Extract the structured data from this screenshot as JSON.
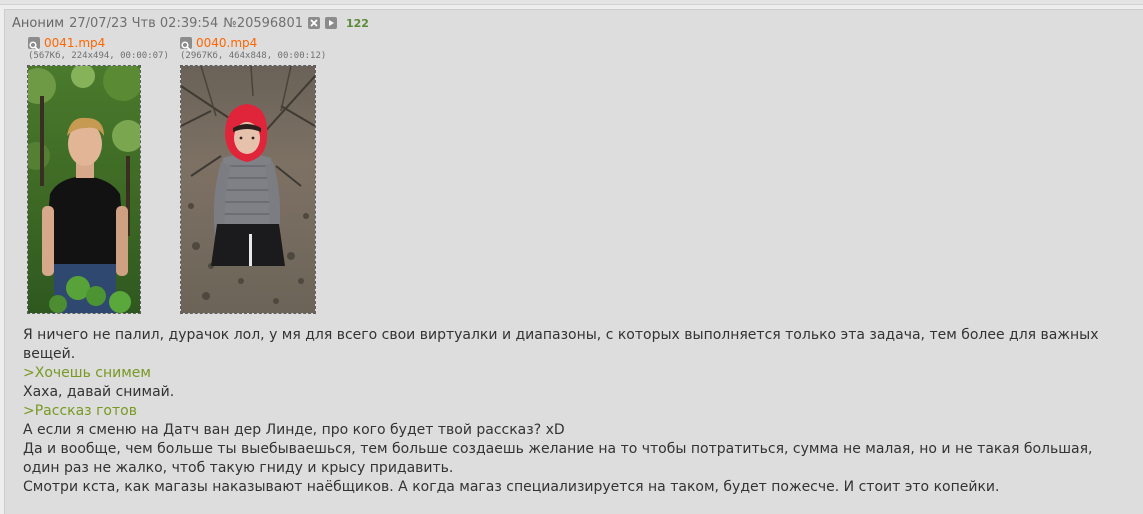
{
  "post": {
    "author": "Аноним",
    "date": "27/07/23 Чтв 02:39:54",
    "number": "№20596801",
    "reply_count": "122",
    "icons": [
      "hide-icon",
      "play-icon"
    ]
  },
  "files": [
    {
      "name": "0041.mp4",
      "meta": "(567Кб, 224x494, 00:00:07)",
      "thumb_icon": "video-thumbnail"
    },
    {
      "name": "0040.mp4",
      "meta": "(2967Кб, 464x848, 00:00:12)",
      "thumb_icon": "video-thumbnail"
    }
  ],
  "message": [
    {
      "type": "text",
      "text": "Я ничего не палил, дурачок лол, у мя для всего свои виртуалки и диапазоны, с которых выполняется только эта задача, тем более для важных вещей."
    },
    {
      "type": "quote",
      "text": ">Хочешь снимем"
    },
    {
      "type": "text",
      "text": "Хаха, давай снимай."
    },
    {
      "type": "quote",
      "text": ">Рассказ готов"
    },
    {
      "type": "text",
      "text": "А если я сменю на Датч ван дер Линде, про кого будет твой рассказ? xD"
    },
    {
      "type": "text",
      "text": "Да и вообще, чем больше ты выебываешься, тем больше создаешь желание на то чтобы потратиться, сумма не малая, но и не такая большая, один раз не жалко, чтоб такую гниду и крысу придавить."
    },
    {
      "type": "text",
      "text": "Смотри кста, как магазы наказывают наёбщиков. А когда магаз специализируется на таком, будет пожесче. И стоит это копейки."
    }
  ],
  "colors": {
    "quote": "#789922",
    "file_link": "#ff6600",
    "counter": "#5a8a3a",
    "post_bg": "#dddddd"
  }
}
